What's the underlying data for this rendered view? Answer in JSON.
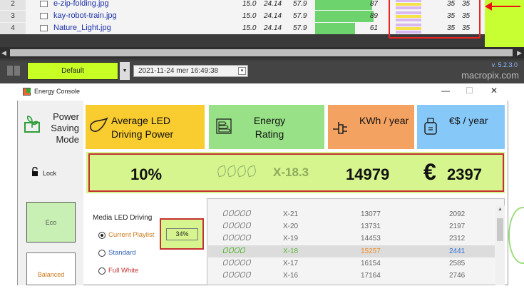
{
  "files": {
    "rows": [
      {
        "index": "2",
        "name": "e-zip-folding.jpg",
        "c1": "15.0",
        "c2": "24.14",
        "c3": "57.9",
        "score": 87,
        "n1": "35",
        "n2": "35"
      },
      {
        "index": "3",
        "name": "kay-robot-train.jpg",
        "c1": "15.0",
        "c2": "24.14",
        "c3": "57.9",
        "score": 89,
        "n1": "35",
        "n2": "35"
      },
      {
        "index": "4",
        "name": "Nature_Light.jpg",
        "c1": "15.0",
        "c2": "24.14",
        "c3": "57.9",
        "score": 61,
        "n1": "35",
        "n2": "35"
      }
    ],
    "score_max": 100
  },
  "toolbar": {
    "preset": "Default",
    "preset_arrow": "▼",
    "date": "2021-11-24  mer  16:49:38",
    "version": "v. 5.2.3.0",
    "brand": "macropix.com"
  },
  "window": {
    "title": "Energy Console",
    "minimize": "—",
    "maximize": "☐",
    "close": "✕"
  },
  "side": {
    "mode_label": "Power Saving Mode",
    "lock_label": "Lock",
    "eco_label": "Eco",
    "balanced_label": "Balanced"
  },
  "headers": {
    "power": "Average LED Driving Power",
    "rating": "Energy Rating",
    "kwh": "KWh / year",
    "cost": "€$ / year"
  },
  "values": {
    "power": "10%",
    "rating": "X-18.3",
    "kwh": "14979",
    "cost_symbol": "€",
    "cost": "2397"
  },
  "media": {
    "label": "Media LED Driving",
    "options": [
      "Current Playlist",
      "Standard",
      "Full White"
    ],
    "selected": 0,
    "percent": "34%"
  },
  "list": [
    {
      "leaves": 5,
      "rating": "X-21",
      "kwh": "13077",
      "cost": "2092",
      "selected": false
    },
    {
      "leaves": 5,
      "rating": "X-20",
      "kwh": "13731",
      "cost": "2197",
      "selected": false
    },
    {
      "leaves": 5,
      "rating": "X-19",
      "kwh": "14453",
      "cost": "2312",
      "selected": false
    },
    {
      "leaves": 4,
      "rating": "X-18",
      "kwh": "15257",
      "cost": "2441",
      "selected": true
    },
    {
      "leaves": 5,
      "rating": "X-17",
      "kwh": "16154",
      "cost": "2585",
      "selected": false
    },
    {
      "leaves": 5,
      "rating": "X-16",
      "kwh": "17164",
      "cost": "2746",
      "selected": false
    }
  ],
  "colors": {
    "accent_green": "#c8ff24",
    "highlight_red": "#c53030",
    "power_yellow": "#f9cc2f",
    "rating_green": "#98e186",
    "kwh_orange": "#f4a261",
    "cost_blue": "#86c9f9",
    "selected_kwh": "#f08c24",
    "selected_cost": "#2a6fd6",
    "selected_rating": "#5fb83a"
  }
}
